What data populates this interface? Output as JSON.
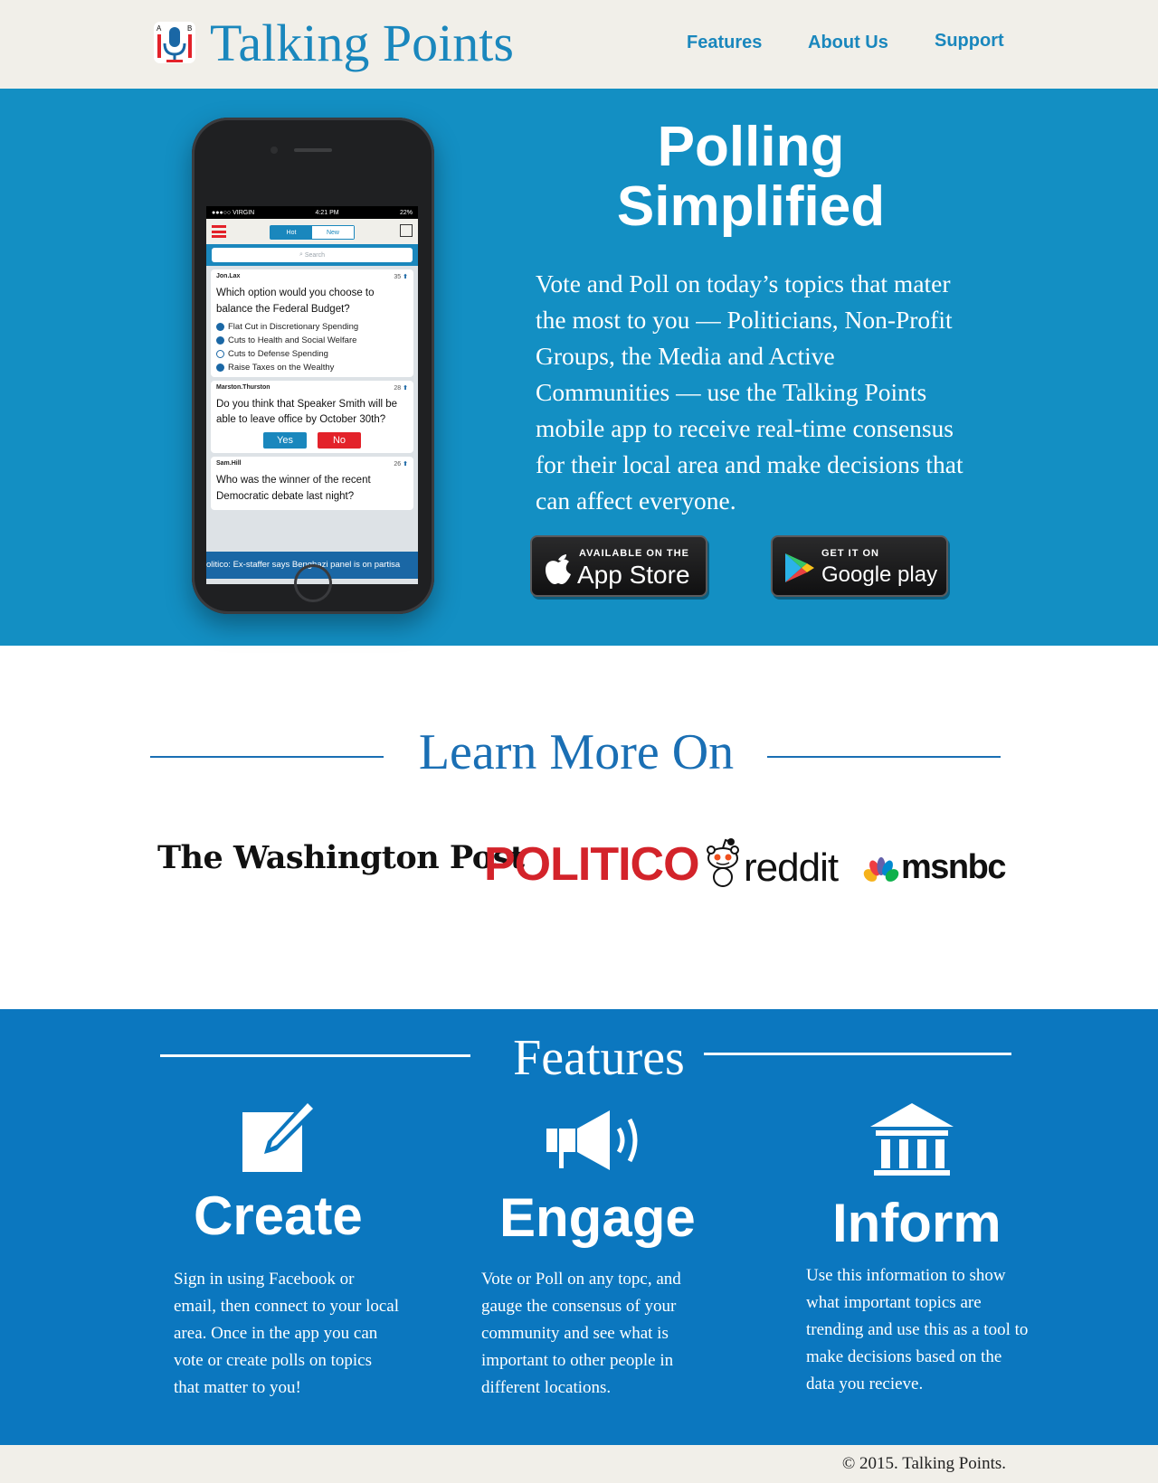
{
  "header": {
    "logo_title": "Talking Points",
    "logo_badge_left": "A",
    "logo_badge_right": "B",
    "nav": [
      "Features",
      "About Us",
      "Support"
    ]
  },
  "hero": {
    "title": "Polling Simplified",
    "description": "Vote and Poll on today’s topics that mater the most to you  — Politicians, Non-Profit Groups, the Media and Active Communities — use the Talking Points mobile app to receive real-time consensus for their local area and make decisions that can affect everyone.",
    "app_store": {
      "small": "AVAILABLE ON THE",
      "big": "App Store"
    },
    "google_play": {
      "small": "GET IT ON",
      "big": "Google play"
    }
  },
  "phone": {
    "status": {
      "carrier": "●●●○○ VIRGIN",
      "time": "4:21 PM",
      "battery": "22%"
    },
    "tabs": {
      "hot": "Hot",
      "new": "New"
    },
    "search_placeholder": "Search",
    "polls": [
      {
        "user": "Jon.Lax",
        "count": "35",
        "question": "Which option would you choose to balance the Federal Budget?",
        "options": [
          "Flat Cut in Discretionary Spending",
          "Cuts to Health and Social Welfare",
          "Cuts to Defense Spending",
          "Raise Taxes on the Wealthy"
        ]
      },
      {
        "user": "Marston.Thurston",
        "count": "28",
        "question": "Do you think that Speaker Smith will be able to leave office by October 30th?",
        "yes": "Yes",
        "no": "No"
      },
      {
        "user": "Sam.Hill",
        "count": "26",
        "question": "Who was the winner of the recent Democratic debate last night?"
      }
    ],
    "ticker": "olitico: Ex-staffer says Benghazi panel is on partisa"
  },
  "learn_more": {
    "title": "Learn More On",
    "sources": [
      "The Washington Post",
      "POLITICO",
      "reddit",
      "msnbc"
    ]
  },
  "features": {
    "title": "Features",
    "items": [
      {
        "icon": "edit-icon",
        "title": "Create",
        "text": "Sign in using Facebook or email, then connect to your local area. Once in the app you can vote or create polls on topics that matter to you!"
      },
      {
        "icon": "megaphone-icon",
        "title": "Engage",
        "text": "Vote or Poll on any topc, and gauge the consensus of your community and see what is important to other people in different locations."
      },
      {
        "icon": "bank-icon",
        "title": "Inform",
        "text": "Use this information to show what important topics are trending and use this as a tool to make decisions based on the data you recieve."
      }
    ]
  },
  "footer": {
    "copyright": "© 2015. Talking Points."
  },
  "colors": {
    "header_bg": "#f1efe9",
    "brand_blue": "#1a87bd",
    "hero_bg": "#138fc3",
    "features_bg": "#0b77bf",
    "heading_blue": "#1a6fb4",
    "politico_red": "#d3232a",
    "no_red": "#e3222a"
  }
}
